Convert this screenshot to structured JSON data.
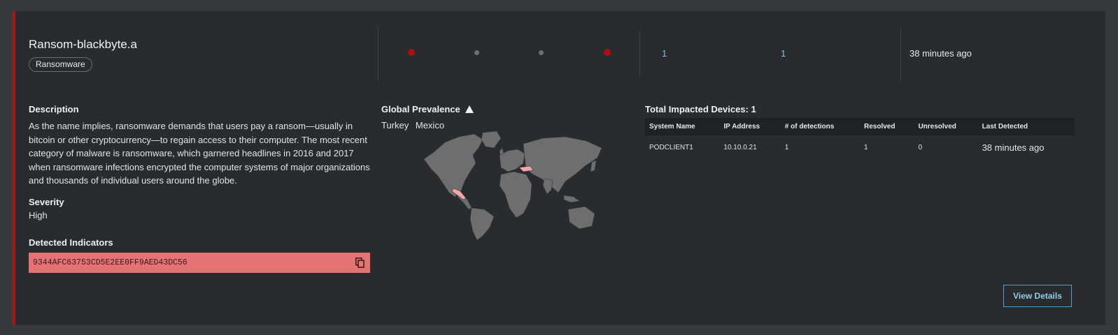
{
  "threat": {
    "name": "Ransom-blackbyte.a",
    "category_tag": "Ransomware"
  },
  "status_dots": [
    "red",
    "grey",
    "grey",
    "red"
  ],
  "counts": {
    "first": "1",
    "second": "1"
  },
  "last_seen": "38 minutes ago",
  "description": {
    "heading": "Description",
    "text": "As the name implies, ransomware demands that users pay a ransom—usually in bitcoin or other cryptocurrency—to regain access to their computer. The most recent category of malware is ransomware, which garnered headlines in 2016 and 2017 when ransomware infections encrypted the computer systems of major organizations and thousands of individual users around the globe."
  },
  "severity": {
    "heading": "Severity",
    "value": "High"
  },
  "indicators": {
    "heading": "Detected Indicators",
    "hash": "9344AFC63753CD5E2EE0FF9AED43DC56",
    "copy_icon": "copy-icon"
  },
  "prevalence": {
    "heading": "Global Prevalence",
    "icon": "warning-triangle-icon",
    "countries": [
      "Turkey",
      "Mexico"
    ],
    "map_land_color": "#6e6e6e",
    "map_highlight_color": "#f4a6a6"
  },
  "devices": {
    "heading": "Total Impacted Devices: 1",
    "columns": [
      "System Name",
      "IP Address",
      "# of detections",
      "Resolved",
      "Unresolved",
      "Last Detected"
    ],
    "rows": [
      [
        "PODCLIENT1",
        "10.10.0.21",
        "1",
        "1",
        "0",
        "38 minutes ago"
      ]
    ]
  },
  "actions": {
    "view_details": "View Details"
  },
  "colors": {
    "accent_red": "#a31717",
    "link_blue": "#7fc3e6",
    "indicator_bg": "#e57373"
  }
}
